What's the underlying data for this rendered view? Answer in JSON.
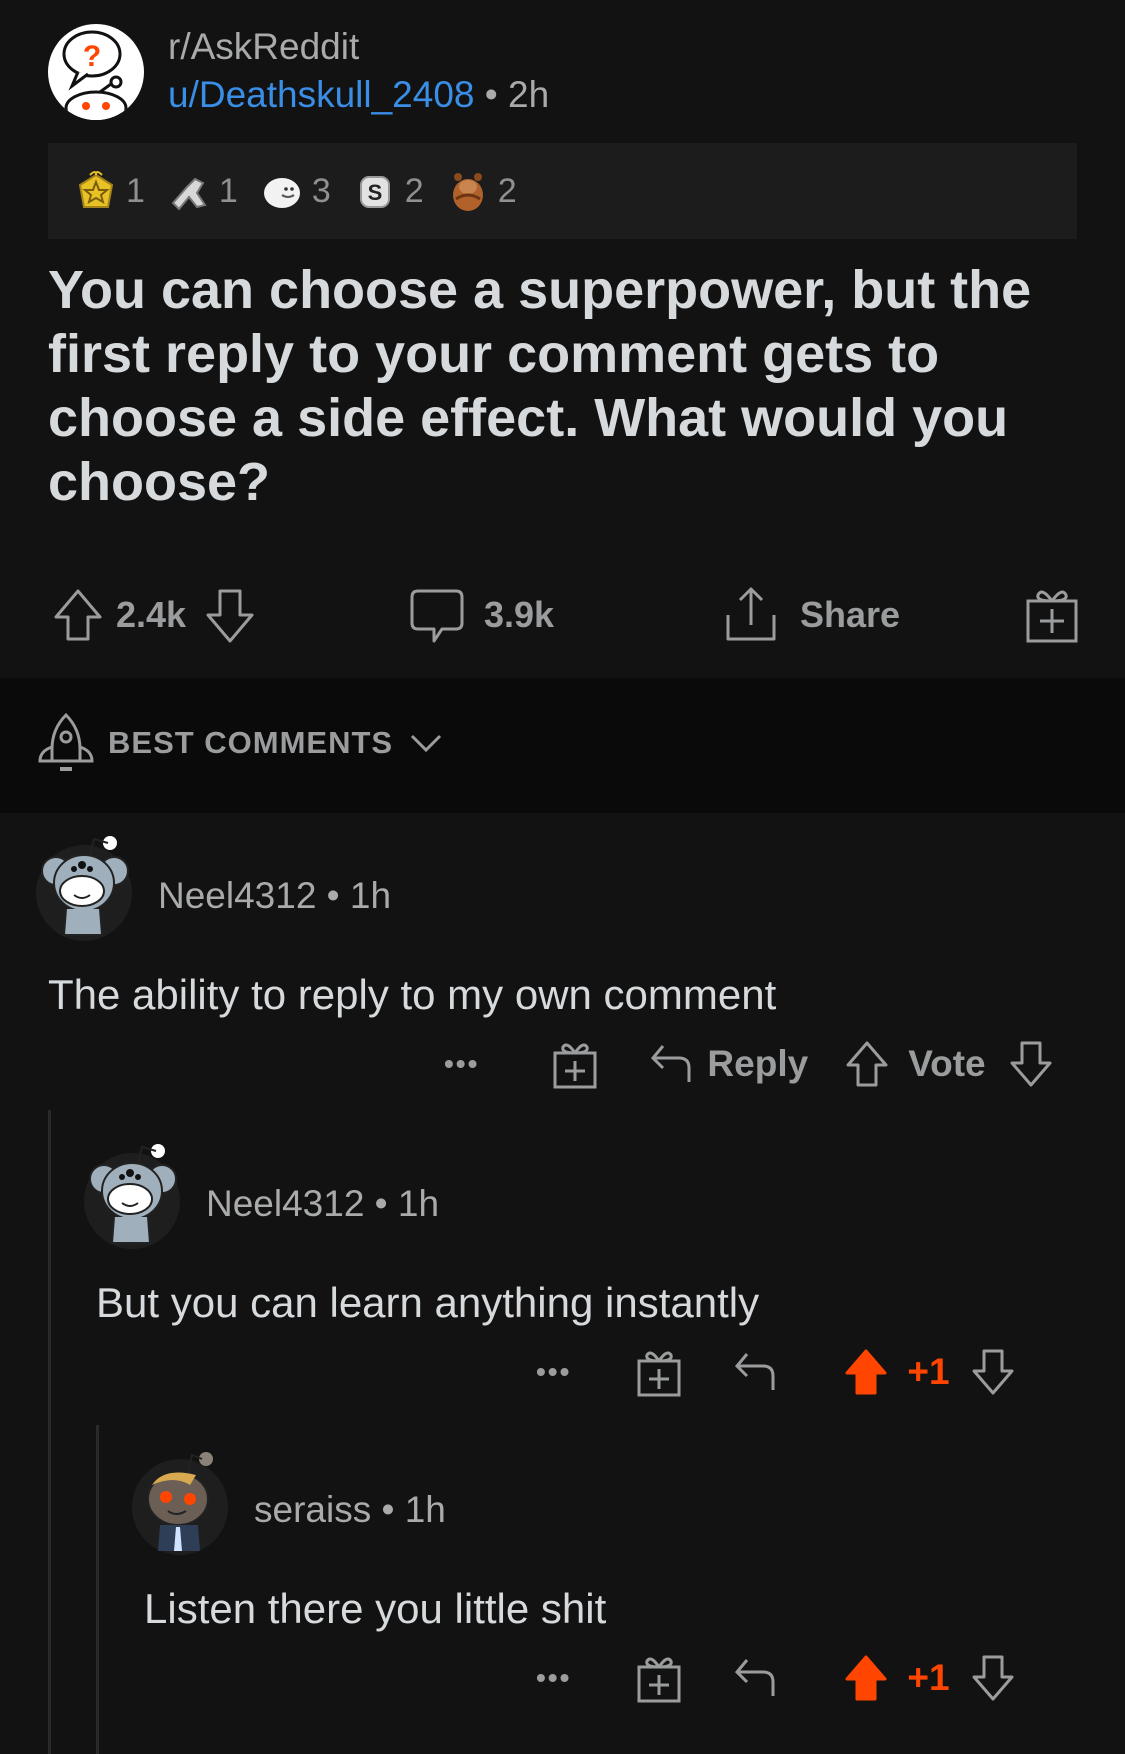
{
  "post": {
    "subreddit": "r/AskReddit",
    "author": "u/Deathskull_2408",
    "separator": " • ",
    "age": "2h",
    "awards": [
      {
        "icon": "helpful-award-icon",
        "count": "1"
      },
      {
        "icon": "wholesome-handshake-award-icon",
        "count": "1"
      },
      {
        "icon": "seal-award-icon",
        "count": "3"
      },
      {
        "icon": "silver-coin-award-icon",
        "count": "2"
      },
      {
        "icon": "bear-award-icon",
        "count": "2"
      }
    ],
    "title": "You can choose a superpower, but the first reply to your comment gets to choose a side effect. What would you choose?",
    "score": "2.4k",
    "comments": "3.9k",
    "share_label": "Share"
  },
  "sort": {
    "label": "BEST COMMENTS"
  },
  "comments": [
    {
      "author": "Neel4312",
      "age": "1h",
      "body": "The ability to reply to my own comment",
      "reply_label": "Reply",
      "vote_label": "Vote",
      "more": "•••"
    },
    {
      "author": "Neel4312",
      "age": "1h",
      "body": "But you can learn anything instantly",
      "score": "+1",
      "more": "•••"
    },
    {
      "author": "seraiss",
      "age": "1h",
      "body": "Listen there you little shit",
      "score": "+1",
      "more": "•••"
    }
  ],
  "colors": {
    "background": "#121212",
    "upvote": "#ff4500",
    "link": "#3a8ee6"
  }
}
